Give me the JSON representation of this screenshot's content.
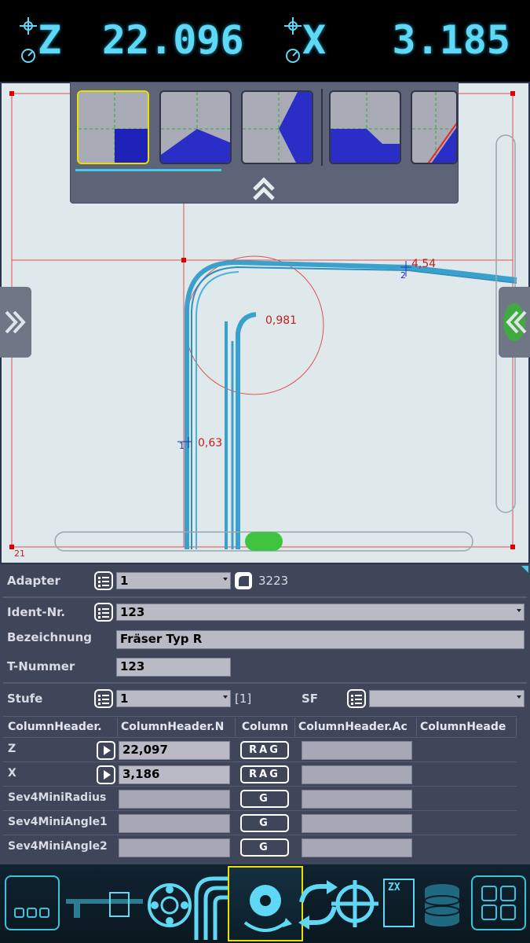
{
  "readout": {
    "z_letter": "Z",
    "z_value": "22.096",
    "x_letter": "X",
    "x_value": "3.185",
    "accent": "#5ed8f5",
    "icons": [
      "axis-target-icon",
      "axis-gauge-icon"
    ]
  },
  "canvas": {
    "dimensions": {
      "angle_top": "4,54",
      "angle_top_marker": "2",
      "radius": "0,981",
      "left_width": "0,63",
      "left_marker": "1",
      "corner_label": "21"
    },
    "picker_tiles": [
      "tool-shape-square",
      "tool-shape-taper",
      "tool-shape-cone",
      "tool-shape-step",
      "tool-shape-angle"
    ],
    "selected_tile": 0
  },
  "form": {
    "adapter_label": "Adapter",
    "adapter_value": "1",
    "adapter_code": "3223",
    "ident_label": "Ident-Nr.",
    "ident_value": "123",
    "bezeichnung_label": "Bezeichnung",
    "bezeichnung_value": "Fräser Typ R",
    "tnummer_label": "T-Nummer",
    "tnummer_value": "123",
    "stufe_label": "Stufe",
    "stufe_value": "1",
    "stufe_index": "[1]",
    "sf_label": "SF",
    "sf_value": ""
  },
  "grid": {
    "headers": [
      "ColumnHeader.",
      "ColumnHeader.N",
      "Column",
      "ColumnHeader.Ac",
      "ColumnHeade"
    ],
    "rows": [
      {
        "name": "Z",
        "value": "22,097",
        "flag": "RAG",
        "extra": ""
      },
      {
        "name": "X",
        "value": "3,186",
        "flag": "RAG",
        "extra": ""
      },
      {
        "name": "Sev4MiniRadius",
        "value": "",
        "flag": "G",
        "extra": ""
      },
      {
        "name": "Sev4MiniAngle1",
        "value": "",
        "flag": "G",
        "extra": ""
      },
      {
        "name": "Sev4MiniAngle2",
        "value": "",
        "flag": "G",
        "extra": ""
      }
    ]
  },
  "toolbar": {
    "items": [
      "menu-icon",
      "caliper-icon",
      "bearing-icon",
      "bend-icon",
      "tool-change-icon",
      "sync-icon",
      "crosshair-icon",
      "zx-file-icon",
      "database-icon",
      "grid-icon"
    ],
    "selected": "tool-change-icon",
    "zx_label": "ZX"
  }
}
